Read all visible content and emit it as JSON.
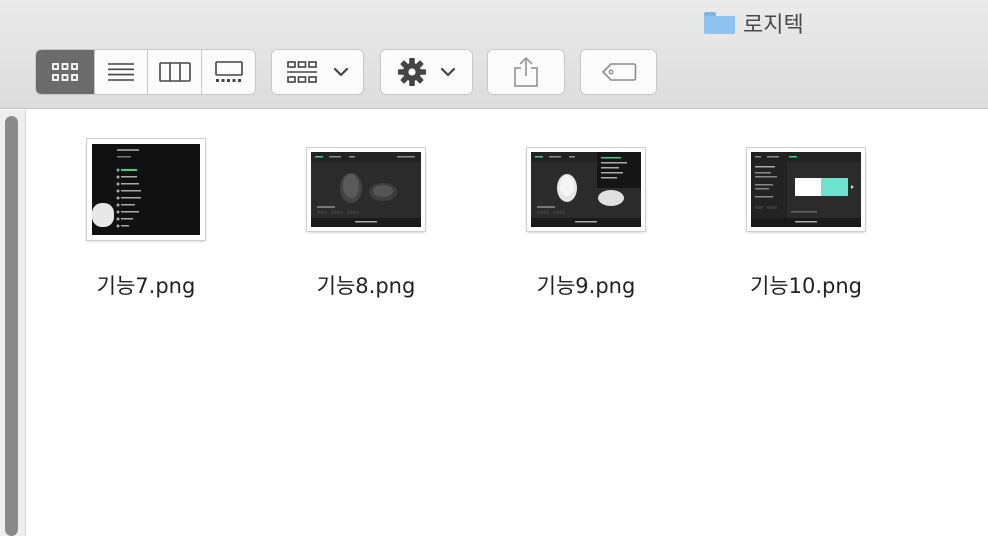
{
  "window": {
    "title": "로지텍",
    "folder_icon": "folder-icon"
  },
  "toolbar": {
    "view_modes": [
      {
        "name": "icon-view",
        "icon": "grid-icon",
        "active": true
      },
      {
        "name": "list-view",
        "icon": "list-icon",
        "active": false
      },
      {
        "name": "column-view",
        "icon": "columns-icon",
        "active": false
      },
      {
        "name": "gallery-view",
        "icon": "gallery-icon",
        "active": false
      }
    ],
    "group_button_icon": "group-icon",
    "action_button_icon": "gear-icon",
    "share_button_icon": "share-icon",
    "tag_button_icon": "tag-icon"
  },
  "files": [
    {
      "name": "기능7.png"
    },
    {
      "name": "기능8.png"
    },
    {
      "name": "기능9.png"
    },
    {
      "name": "기능10.png"
    }
  ],
  "colors": {
    "accent_green": "#3ecf8e",
    "teal": "#6fe2cf",
    "dark_ui": "#2b2b2b",
    "folder": "#8fc3f2"
  }
}
